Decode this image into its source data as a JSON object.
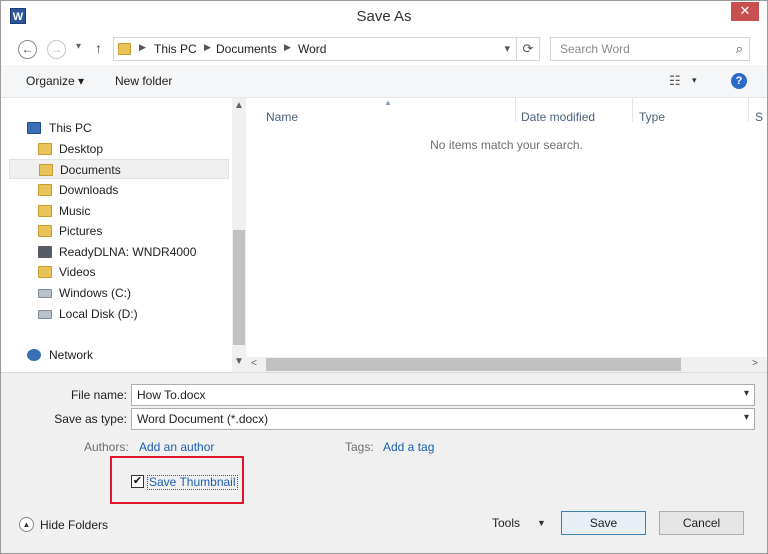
{
  "window": {
    "title": "Save As",
    "app_icon_letter": "W",
    "close_glyph": "✕"
  },
  "nav": {
    "back_glyph": "←",
    "forward_glyph": "→",
    "recent_glyph": "▾",
    "up_glyph": "↑",
    "breadcrumbs": [
      "This PC",
      "Documents",
      "Word"
    ],
    "breadcrumb_sep": "▶",
    "refresh_glyph": "⟳",
    "search_placeholder": "Search Word",
    "search_glyph": "⌕"
  },
  "toolbar": {
    "organize_label": "Organize ▾",
    "new_folder_label": "New folder",
    "view_glyph": "☷",
    "view_drop_glyph": "▾",
    "help_glyph": "?"
  },
  "sidebar": {
    "items": [
      {
        "label": "This PC",
        "icon": "computer-icon"
      },
      {
        "label": "Desktop",
        "icon": "folder-icon"
      },
      {
        "label": "Documents",
        "icon": "folder-icon",
        "selected": true
      },
      {
        "label": "Downloads",
        "icon": "folder-icon"
      },
      {
        "label": "Music",
        "icon": "folder-icon"
      },
      {
        "label": "Pictures",
        "icon": "folder-icon"
      },
      {
        "label": "ReadyDLNA: WNDR4000",
        "icon": "media-server-icon"
      },
      {
        "label": "Videos",
        "icon": "folder-icon"
      },
      {
        "label": "Windows (C:)",
        "icon": "drive-icon"
      },
      {
        "label": "Local Disk (D:)",
        "icon": "drive-icon"
      },
      {
        "label": "Network",
        "icon": "network-icon"
      }
    ]
  },
  "filelist": {
    "columns": [
      "Name",
      "Date modified",
      "Type",
      "S"
    ],
    "empty_message": "No items match your search."
  },
  "form": {
    "file_name_label": "File name:",
    "file_name_value": "How To.docx",
    "save_type_label": "Save as type:",
    "save_type_value": "Word Document (*.docx)",
    "authors_label": "Authors:",
    "authors_link": "Add an author",
    "tags_label": "Tags:",
    "tags_link": "Add a tag",
    "thumbnail_label": "Save Thumbnail",
    "thumbnail_checked": true,
    "check_glyph": "✔"
  },
  "footer": {
    "hide_folders_label": "Hide Folders",
    "hide_glyph": "▲",
    "tools_label": "Tools",
    "tools_drop_glyph": "▼",
    "save_label": "Save",
    "cancel_label": "Cancel"
  },
  "colors": {
    "link": "#1a5fb4",
    "highlight_box": "#e0162b",
    "app_icon": "#2b579a",
    "close_button": "#c75050"
  }
}
